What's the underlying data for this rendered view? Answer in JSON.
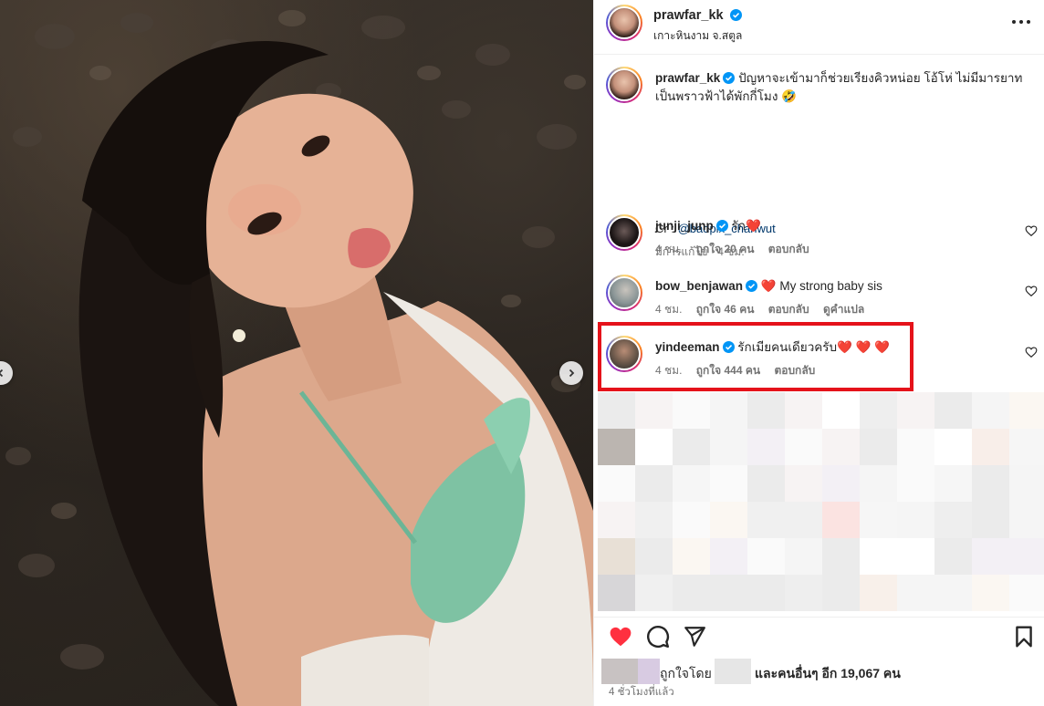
{
  "post": {
    "username": "prawfar_kk",
    "location": "เกาะหินงาม จ.สตูล",
    "caption": {
      "username": "prawfar_kk",
      "text_line1": "ปัญหาจะเข้ามาก็ช่วยเรียงคิวหน่อย โอ้โห่ ไม่มีมารยาท",
      "text_line2": "เป็นพราวฟ้าได้พักกี่โมง 🤣",
      "credit_prefix": "Cr : ",
      "credit_handle": "@badpix_chanwut",
      "meta": "มีการแก้ไข · 4 ชม."
    }
  },
  "comments": [
    {
      "username": "junji_junp",
      "text": "รัก",
      "emoji": "❤️",
      "time": "4 ชม.",
      "likes": "ถูกใจ 20 คน",
      "reply": "ตอบกลับ",
      "translate": ""
    },
    {
      "username": "bow_benjawan",
      "text": "My strong baby sis",
      "emoji": "❤️",
      "time": "4 ชม.",
      "likes": "ถูกใจ 46 คน",
      "reply": "ตอบกลับ",
      "translate": "ดูคำแปล"
    },
    {
      "username": "yindeeman",
      "text": "รักเมียคนเดียวครับ",
      "emoji": "❤️ ❤️ ❤️",
      "time": "4 ชม.",
      "likes": "ถูกใจ 444 คน",
      "reply": "ตอบกลับ",
      "translate": ""
    }
  ],
  "likes": {
    "liked_by": "ถูกใจโดย",
    "and_others": "และคนอื่นๆ อีก 19,067 คน"
  },
  "time_ago": "4 ชั่วโมงที่แล้ว",
  "icons": {
    "like": "heart-filled-icon",
    "comment": "comment-bubble-icon",
    "share": "paper-plane-icon",
    "save": "bookmark-icon",
    "more": "more-dots-icon",
    "verified": "verified-badge-icon"
  },
  "colors": {
    "like_red": "#ff3040",
    "highlight_red": "#e5121a",
    "verified_blue": "#0095f6",
    "link_blue": "#00376b"
  }
}
